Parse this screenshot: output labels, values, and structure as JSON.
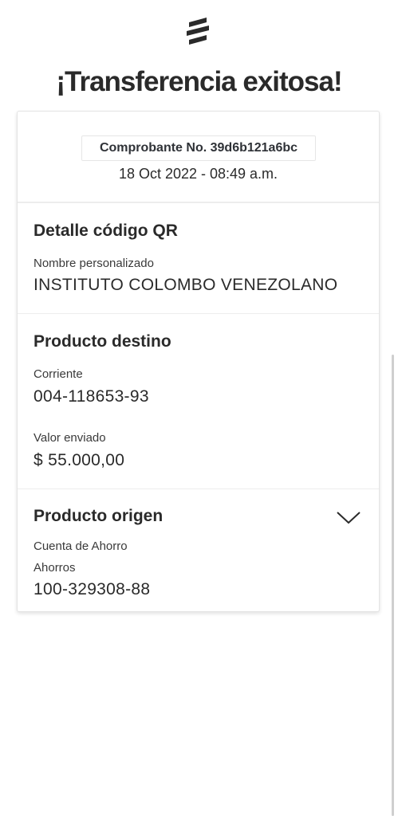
{
  "header": {
    "logo_icon": "bank-flame-logo",
    "title": "¡Transferencia exitosa!"
  },
  "receipt": {
    "number_label": "Comprobante No. 39d6b121a6bc",
    "date": "18 Oct 2022 - 08:49 a.m."
  },
  "qr_detail": {
    "title": "Detalle código QR",
    "name_label": "Nombre personalizado",
    "name_value": "INSTITUTO COLOMBO VENEZOLANO"
  },
  "destination": {
    "title": "Producto destino",
    "account_type": "Corriente",
    "account_number": "004-118653-93",
    "amount_label": "Valor enviado",
    "amount_value": "$ 55.000,00"
  },
  "origin": {
    "title": "Producto origen",
    "toggle_icon": "chevron-down-icon",
    "account_name": "Cuenta de Ahorro",
    "account_type": "Ahorros",
    "account_number": "100-329308-88"
  }
}
